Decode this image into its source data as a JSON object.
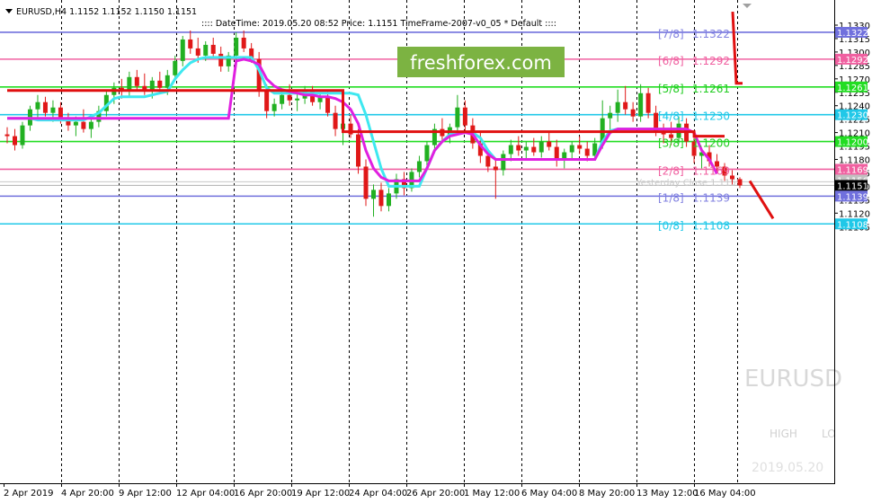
{
  "header": {
    "symbol_info": "EURUSD,H4  1.1152 1.1152 1.1150 1.1151",
    "indicator_info": ":::: DateTime: 2019.05.20 08:52   Price: 1.1151   TimeFrame-2007-v0_05   *  Default  ::::"
  },
  "watermark": "freshforex.com",
  "ghost_labels": {
    "symbol": "EURUSD",
    "high": "HIGH",
    "low": "LO",
    "date": "2019.05.20",
    "yesterday_close": "Yesterday Close 1.1155"
  },
  "colors": {
    "bull": "#22b022",
    "bear": "#e01818",
    "cyan": "#3ee8f0",
    "magenta": "#e020e0",
    "red_line": "#e01010",
    "green_level": "#22dd22",
    "blue_level": "#7070dd",
    "pink_level": "#f060a0",
    "cyan_level": "#20c8e8"
  },
  "chart_data": {
    "type": "candlestick",
    "symbol": "EURUSD",
    "timeframe": "H4",
    "ylim": [
      1.1098,
      1.1345
    ],
    "y_ticks": [
      "1.1330",
      "1.1315",
      "1.1300",
      "1.1285",
      "1.1270",
      "1.1255",
      "1.1240",
      "1.1225",
      "1.1210",
      "1.1195",
      "1.1180",
      "1.1165",
      "1.1150",
      "1.1135",
      "1.1120",
      "1.1105"
    ],
    "x_ticks": [
      "2 Apr 2019",
      "4 Apr 20:00",
      "9 Apr 12:00",
      "12 Apr 04:00",
      "16 Apr 20:00",
      "19 Apr 12:00",
      "24 Apr 04:00",
      "26 Apr 20:00",
      "1 May 12:00",
      "6 May 04:00",
      "8 May 20:00",
      "13 May 12:00",
      "16 May 04:00"
    ],
    "murrey_levels": [
      {
        "label": "[7/8]",
        "value": "1.1322",
        "price": 1.1322,
        "color": "#7070dd",
        "text_color": "#8080e0"
      },
      {
        "label": "[6/8]",
        "value": "1.1292",
        "price": 1.1292,
        "color": "#f060a0",
        "text_color": "#f060a0"
      },
      {
        "label": "[5/8]",
        "value": "1.1261",
        "price": 1.1261,
        "color": "#22dd22",
        "text_color": "#22cc22"
      },
      {
        "label": "[4/8]",
        "value": "1.1230",
        "price": 1.123,
        "color": "#20c8e8",
        "text_color": "#20c8e8"
      },
      {
        "label": "[3/8]",
        "value": "1.1200",
        "price": 1.12,
        "color": "#22dd22",
        "text_color": "#22cc22"
      },
      {
        "label": "[2/8]",
        "value": "1.1169",
        "price": 1.1169,
        "color": "#f060a0",
        "text_color": "#f060a0"
      },
      {
        "label": "[1/8]",
        "value": "1.1139",
        "price": 1.1139,
        "color": "#7070dd",
        "text_color": "#8080e0"
      },
      {
        "label": "[0/8]",
        "value": "1.1108",
        "price": 1.1108,
        "color": "#20c8e8",
        "text_color": "#20c8e8"
      }
    ],
    "price_tags": [
      {
        "text": "1.1322",
        "price": 1.1322,
        "bg": "#7070dd"
      },
      {
        "text": "1.1292",
        "price": 1.1292,
        "bg": "#f060a0"
      },
      {
        "text": "1.1261",
        "price": 1.1261,
        "bg": "#22dd22"
      },
      {
        "text": "1.1230",
        "price": 1.123,
        "bg": "#20c8e8"
      },
      {
        "text": "1.1200",
        "price": 1.12,
        "bg": "#22dd22"
      },
      {
        "text": "1.1169",
        "price": 1.1169,
        "bg": "#f060a0"
      },
      {
        "text": "1.1156",
        "price": 1.1157,
        "bg": "#c0c0c0"
      },
      {
        "text": "1.1151",
        "price": 1.1151,
        "bg": "#000000"
      },
      {
        "text": "1.1139",
        "price": 1.1139,
        "bg": "#7070dd"
      },
      {
        "text": "1.1108",
        "price": 1.1108,
        "bg": "#20c8e8"
      }
    ],
    "current_price": 1.1151,
    "yesterday_close": 1.1155,
    "candles_ohlc_approx": [
      [
        1.1208,
        1.1216,
        1.1198,
        1.1206
      ],
      [
        1.1206,
        1.1214,
        1.119,
        1.1196
      ],
      [
        1.1196,
        1.1222,
        1.1192,
        1.1218
      ],
      [
        1.1218,
        1.124,
        1.1212,
        1.1236
      ],
      [
        1.1236,
        1.1252,
        1.1226,
        1.1244
      ],
      [
        1.1244,
        1.125,
        1.1228,
        1.1232
      ],
      [
        1.1232,
        1.1246,
        1.1222,
        1.1238
      ],
      [
        1.1238,
        1.1244,
        1.122,
        1.1226
      ],
      [
        1.1226,
        1.1232,
        1.1212,
        1.1218
      ],
      [
        1.1218,
        1.1228,
        1.1206,
        1.1222
      ],
      [
        1.1222,
        1.1236,
        1.121,
        1.1214
      ],
      [
        1.1214,
        1.1226,
        1.1204,
        1.1222
      ],
      [
        1.1222,
        1.124,
        1.1216,
        1.1234
      ],
      [
        1.1234,
        1.1258,
        1.1228,
        1.1252
      ],
      [
        1.1252,
        1.1266,
        1.1242,
        1.126
      ],
      [
        1.126,
        1.127,
        1.1248,
        1.1256
      ],
      [
        1.1256,
        1.1278,
        1.125,
        1.1272
      ],
      [
        1.1272,
        1.128,
        1.1258,
        1.1262
      ],
      [
        1.1262,
        1.1276,
        1.1252,
        1.1258
      ],
      [
        1.1258,
        1.1272,
        1.1248,
        1.1268
      ],
      [
        1.1268,
        1.1278,
        1.1254,
        1.126
      ],
      [
        1.126,
        1.128,
        1.1252,
        1.1274
      ],
      [
        1.1274,
        1.1296,
        1.1268,
        1.129
      ],
      [
        1.129,
        1.1318,
        1.1284,
        1.1314
      ],
      [
        1.1314,
        1.1324,
        1.1298,
        1.1304
      ],
      [
        1.1304,
        1.1316,
        1.1288,
        1.1296
      ],
      [
        1.1296,
        1.1312,
        1.129,
        1.1308
      ],
      [
        1.1308,
        1.1316,
        1.1294,
        1.1298
      ],
      [
        1.1298,
        1.1306,
        1.1278,
        1.1284
      ],
      [
        1.1284,
        1.13,
        1.1278,
        1.1296
      ],
      [
        1.1296,
        1.1322,
        1.129,
        1.1316
      ],
      [
        1.1316,
        1.1324,
        1.13,
        1.1304
      ],
      [
        1.1304,
        1.131,
        1.1288,
        1.1292
      ],
      [
        1.1292,
        1.13,
        1.125,
        1.1256
      ],
      [
        1.1256,
        1.1264,
        1.1226,
        1.1234
      ],
      [
        1.1234,
        1.1248,
        1.1228,
        1.1242
      ],
      [
        1.1242,
        1.1258,
        1.1236,
        1.1252
      ],
      [
        1.1252,
        1.1264,
        1.124,
        1.1246
      ],
      [
        1.1246,
        1.1254,
        1.1234,
        1.1248
      ],
      [
        1.1248,
        1.1262,
        1.1242,
        1.1256
      ],
      [
        1.1256,
        1.1262,
        1.124,
        1.1244
      ],
      [
        1.1244,
        1.1254,
        1.1236,
        1.125
      ],
      [
        1.125,
        1.1256,
        1.1228,
        1.1232
      ],
      [
        1.1232,
        1.124,
        1.1206,
        1.1214
      ],
      [
        1.1214,
        1.1226,
        1.1196,
        1.122
      ],
      [
        1.122,
        1.123,
        1.1204,
        1.1208
      ],
      [
        1.1208,
        1.1214,
        1.1164,
        1.1172
      ],
      [
        1.1172,
        1.118,
        1.1128,
        1.1136
      ],
      [
        1.1136,
        1.1152,
        1.1116,
        1.1146
      ],
      [
        1.1146,
        1.1154,
        1.1122,
        1.1128
      ],
      [
        1.1128,
        1.1148,
        1.1122,
        1.1142
      ],
      [
        1.1142,
        1.1164,
        1.1136,
        1.1158
      ],
      [
        1.1158,
        1.1166,
        1.114,
        1.1148
      ],
      [
        1.1148,
        1.117,
        1.1144,
        1.1166
      ],
      [
        1.1166,
        1.1184,
        1.116,
        1.1178
      ],
      [
        1.1178,
        1.12,
        1.1172,
        1.1196
      ],
      [
        1.1196,
        1.122,
        1.119,
        1.1214
      ],
      [
        1.1214,
        1.1226,
        1.12,
        1.1206
      ],
      [
        1.1206,
        1.122,
        1.1198,
        1.1216
      ],
      [
        1.1216,
        1.1252,
        1.121,
        1.1238
      ],
      [
        1.1238,
        1.1246,
        1.1212,
        1.1218
      ],
      [
        1.1218,
        1.1226,
        1.1192,
        1.1198
      ],
      [
        1.1198,
        1.1212,
        1.1176,
        1.1184
      ],
      [
        1.1184,
        1.1192,
        1.1166,
        1.1172
      ],
      [
        1.1172,
        1.118,
        1.1136,
        1.1168
      ],
      [
        1.1168,
        1.119,
        1.1162,
        1.1186
      ],
      [
        1.1186,
        1.1202,
        1.1178,
        1.1196
      ],
      [
        1.1196,
        1.1206,
        1.1184,
        1.119
      ],
      [
        1.119,
        1.12,
        1.118,
        1.1194
      ],
      [
        1.1194,
        1.1204,
        1.1184,
        1.1188
      ],
      [
        1.1188,
        1.1206,
        1.1182,
        1.12
      ],
      [
        1.12,
        1.1212,
        1.119,
        1.1194
      ],
      [
        1.1194,
        1.1202,
        1.1172,
        1.118
      ],
      [
        1.118,
        1.1192,
        1.117,
        1.1188
      ],
      [
        1.1188,
        1.12,
        1.118,
        1.1196
      ],
      [
        1.1196,
        1.1206,
        1.1186,
        1.1192
      ],
      [
        1.1192,
        1.12,
        1.1178,
        1.1184
      ],
      [
        1.1184,
        1.1204,
        1.118,
        1.1198
      ],
      [
        1.1198,
        1.1246,
        1.1192,
        1.1226
      ],
      [
        1.1226,
        1.124,
        1.121,
        1.1232
      ],
      [
        1.1232,
        1.1258,
        1.1222,
        1.1244
      ],
      [
        1.1244,
        1.1262,
        1.123,
        1.1236
      ],
      [
        1.1236,
        1.1244,
        1.1222,
        1.1228
      ],
      [
        1.1228,
        1.1264,
        1.1222,
        1.1254
      ],
      [
        1.1254,
        1.126,
        1.1226,
        1.1232
      ],
      [
        1.1232,
        1.124,
        1.1206,
        1.1212
      ],
      [
        1.1212,
        1.122,
        1.1198,
        1.1208
      ],
      [
        1.1208,
        1.1222,
        1.1196,
        1.1204
      ],
      [
        1.1204,
        1.1228,
        1.1198,
        1.122
      ],
      [
        1.122,
        1.1226,
        1.1194,
        1.12
      ],
      [
        1.12,
        1.1206,
        1.1176,
        1.1184
      ],
      [
        1.1184,
        1.1192,
        1.117,
        1.1188
      ],
      [
        1.1188,
        1.1196,
        1.1172,
        1.1178
      ],
      [
        1.1178,
        1.1186,
        1.1164,
        1.1172
      ],
      [
        1.1172,
        1.1176,
        1.1156,
        1.1162
      ],
      [
        1.1162,
        1.1168,
        1.1152,
        1.1158
      ],
      [
        1.1158,
        1.116,
        1.1148,
        1.1151
      ]
    ],
    "red_step_line_approx": [
      {
        "from": 0,
        "to": 44,
        "price": 1.1257
      },
      {
        "from": 44,
        "to": 90,
        "price": 1.1211
      },
      {
        "from": 90,
        "to": 94,
        "price": 1.1206
      }
    ],
    "red_vertical_line_approx": {
      "top": 1.1345,
      "bottom": 1.1265
    },
    "red_projection_approx": {
      "from": 1.1156,
      "to": 1.1114
    },
    "cyan_line_approx": [
      1.1226,
      1.1226,
      1.1226,
      1.1226,
      1.1224,
      1.1224,
      1.1224,
      1.1224,
      1.1224,
      1.1224,
      1.1224,
      1.1228,
      1.1232,
      1.124,
      1.1248,
      1.125,
      1.125,
      1.125,
      1.125,
      1.1252,
      1.1254,
      1.1256,
      1.127,
      1.128,
      1.1288,
      1.1292,
      1.1294,
      1.1294,
      1.1294,
      1.1294,
      1.1294,
      1.1294,
      1.1294,
      1.128,
      1.126,
      1.1254,
      1.1254,
      1.1254,
      1.1254,
      1.1254,
      1.1254,
      1.1254,
      1.1254,
      1.1254,
      1.1254,
      1.1254,
      1.1252,
      1.123,
      1.12,
      1.117,
      1.115,
      1.115,
      1.115,
      1.115,
      1.115,
      1.117,
      1.119,
      1.12,
      1.1208,
      1.121,
      1.121,
      1.121,
      1.1204,
      1.119,
      1.118,
      1.118,
      1.118,
      1.118,
      1.118,
      1.118,
      1.118,
      1.118,
      1.118,
      1.118,
      1.118,
      1.118,
      1.118,
      1.118,
      1.12,
      1.1212,
      1.1214,
      1.1214,
      1.1214,
      1.1214,
      1.1214,
      1.1214,
      1.1214,
      1.1214,
      1.1214,
      1.1214
    ],
    "magenta_line_approx": [
      1.1226,
      1.1226,
      1.1226,
      1.1226,
      1.1226,
      1.1226,
      1.1226,
      1.1226,
      1.1226,
      1.1226,
      1.1226,
      1.1226,
      1.1226,
      1.1226,
      1.1226,
      1.1226,
      1.1226,
      1.1226,
      1.1226,
      1.1226,
      1.1226,
      1.1226,
      1.1226,
      1.1226,
      1.1226,
      1.1226,
      1.1226,
      1.1226,
      1.1226,
      1.1226,
      1.129,
      1.1292,
      1.129,
      1.1286,
      1.127,
      1.1262,
      1.1258,
      1.1256,
      1.1254,
      1.1252,
      1.1252,
      1.125,
      1.125,
      1.1248,
      1.1244,
      1.1236,
      1.122,
      1.119,
      1.117,
      1.116,
      1.1156,
      1.1156,
      1.1156,
      1.1156,
      1.1156,
      1.117,
      1.119,
      1.12,
      1.1206,
      1.1208,
      1.121,
      1.1208,
      1.1196,
      1.1186,
      1.118,
      1.118,
      1.118,
      1.118,
      1.118,
      1.118,
      1.118,
      1.118,
      1.118,
      1.118,
      1.118,
      1.118,
      1.118,
      1.118,
      1.1196,
      1.121,
      1.1214,
      1.1214,
      1.1214,
      1.1214,
      1.1214,
      1.1214,
      1.1214,
      1.1214,
      1.1214,
      1.1214,
      1.121,
      1.119,
      1.118,
      1.1164
    ]
  }
}
